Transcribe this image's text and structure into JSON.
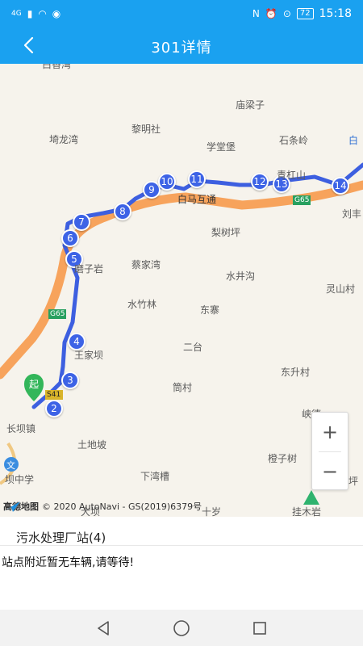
{
  "status_bar": {
    "network": "4G",
    "battery": "72",
    "time": "15:18"
  },
  "app_bar": {
    "title": "301详情"
  },
  "map": {
    "places": [
      {
        "name": "白香湾"
      },
      {
        "name": "庙梁子"
      },
      {
        "name": "黎明社"
      },
      {
        "name": "埼龙湾"
      },
      {
        "name": "学堂堡"
      },
      {
        "name": "石条岭"
      },
      {
        "name": "白"
      },
      {
        "name": "青杠山"
      },
      {
        "name": "白马互通"
      },
      {
        "name": "刘丰"
      },
      {
        "name": "梨树坪"
      },
      {
        "name": "蔡家湾"
      },
      {
        "name": "磨子岩"
      },
      {
        "name": "水井沟"
      },
      {
        "name": "灵山村"
      },
      {
        "name": "水竹林"
      },
      {
        "name": "东寨"
      },
      {
        "name": "王家坝"
      },
      {
        "name": "二台"
      },
      {
        "name": "东升村"
      },
      {
        "name": "筒村"
      },
      {
        "name": "长坝镇"
      },
      {
        "name": "峡德"
      },
      {
        "name": "土地坡"
      },
      {
        "name": "橙子树"
      },
      {
        "name": "坝中学"
      },
      {
        "name": "下湾槽"
      },
      {
        "name": "坪"
      },
      {
        "name": "挂木岩"
      },
      {
        "name": "大坝"
      },
      {
        "name": "十岁"
      }
    ],
    "highway_label": "G65",
    "s_route_label": "S41",
    "stops": [
      "2",
      "3",
      "4",
      "5",
      "6",
      "7",
      "8",
      "9",
      "10",
      "11",
      "12",
      "13",
      "14"
    ],
    "start_label": "起",
    "school_label": "文",
    "zoom_in": "+",
    "zoom_out": "−",
    "attribution_logo_text": "高德地图",
    "attribution": "© 2020 AutoNavi - GS(2019)6379号"
  },
  "station": {
    "name": "污水处理厂站(4)"
  },
  "message": "站点附近暂无车辆,请等待!",
  "colors": {
    "accent": "#1aa1f0",
    "route": "#3d5fe0",
    "highway": "#f7a35c"
  },
  "icons": {
    "back": "chevron-left-icon",
    "nav_back": "triangle-back-icon",
    "nav_home": "circle-home-icon",
    "nav_recent": "square-recent-icon"
  }
}
